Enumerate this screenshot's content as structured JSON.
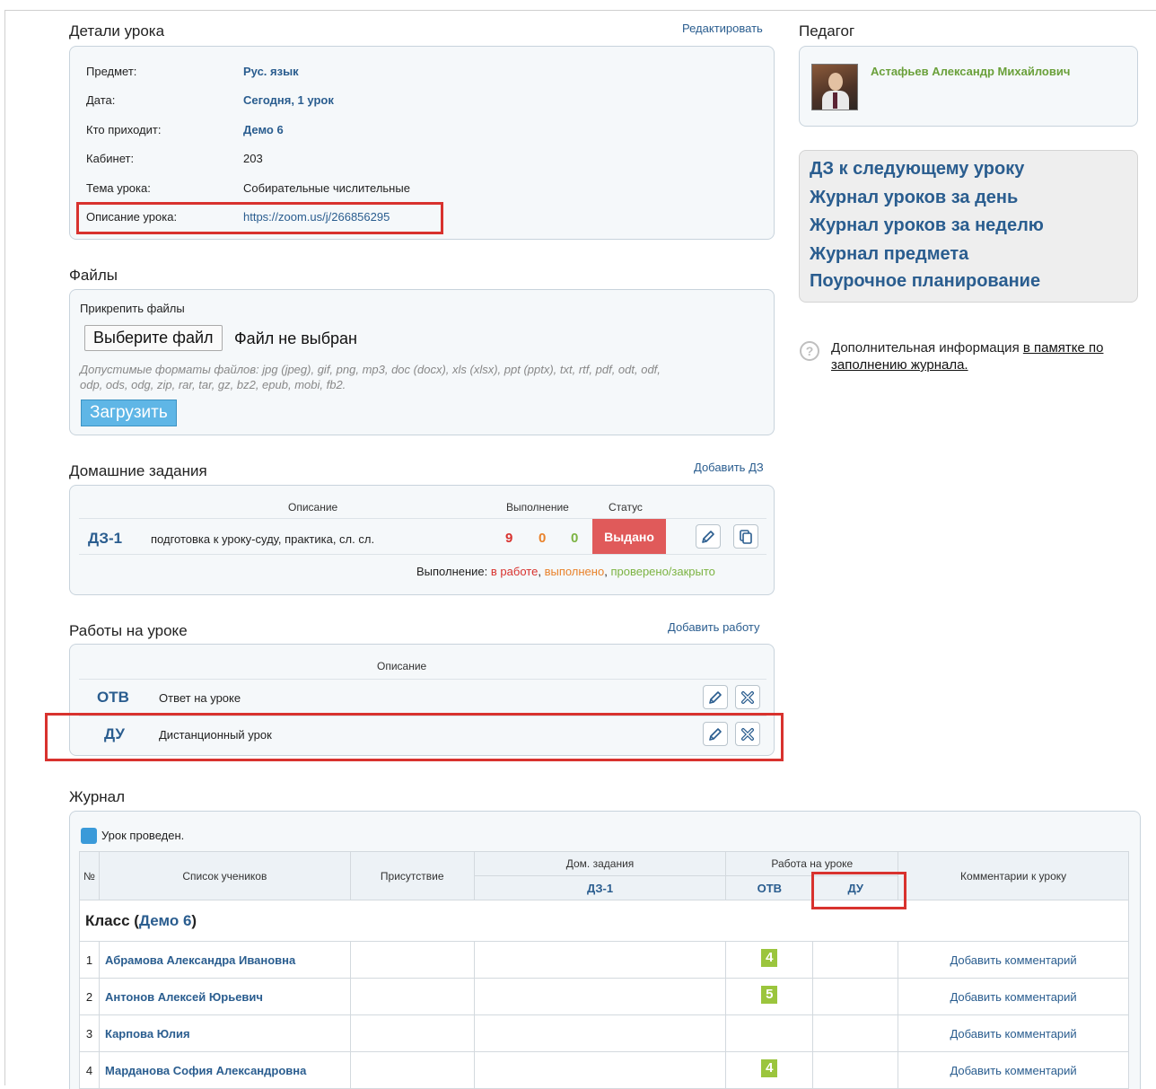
{
  "details": {
    "title": "Детали урока",
    "edit_link": "Редактировать",
    "rows": [
      {
        "label": "Предмет:",
        "value": "Рус. язык"
      },
      {
        "label": "Дата:",
        "value": "Сегодня, 1 урок"
      },
      {
        "label": "Кто приходит:",
        "value": "Демо 6"
      },
      {
        "label": "Кабинет:",
        "value": "203"
      },
      {
        "label": "Тема урока:",
        "value": "Собирательные числительные"
      },
      {
        "label": "Описание урока:",
        "value": "https://zoom.us/j/266856295"
      }
    ]
  },
  "files": {
    "title": "Файлы",
    "attach_label": "Прикрепить файлы",
    "choose_button": "Выберите файл",
    "no_file": "Файл не выбран",
    "formats_line1": "Допустимые форматы файлов: jpg (jpeg), gif, png, mp3, doc (docx), xls (xlsx), ppt (pptx), txt, rtf, pdf, odt, odf,",
    "formats_line2": "odp, ods, odg, zip, rar, tar, gz, bz2, epub, mobi, fb2.",
    "upload_button": "Загрузить"
  },
  "homework": {
    "title": "Домашние задания",
    "add_link": "Добавить ДЗ",
    "headers": {
      "description": "Описание",
      "completion": "Выполнение",
      "status": "Статус"
    },
    "row": {
      "code": "ДЗ-1",
      "description": "подготовка к уроку-суду, практика, сл. сл.",
      "in_progress": "9",
      "done": "0",
      "checked": "0",
      "status": "Выдано"
    },
    "legend": {
      "prefix": "Выполнение:",
      "in_progress": "в работе",
      "sep1": ",",
      "done": "выполнено",
      "sep2": ",",
      "checked": "проверено/закрыто"
    }
  },
  "works": {
    "title": "Работы на уроке",
    "add_link": "Добавить работу",
    "header": "Описание",
    "rows": [
      {
        "code": "ОТВ",
        "description": "Ответ на уроке"
      },
      {
        "code": "ДУ",
        "description": "Дистанционный урок"
      }
    ]
  },
  "teacher": {
    "title": "Педагог",
    "name": "Астафьев Александр Михайлович"
  },
  "quick_links": [
    "ДЗ к следующему уроку",
    "Журнал уроков за день",
    "Журнал уроков за неделю",
    "Журнал предмета",
    "Поурочное планирование"
  ],
  "help": {
    "icon": "?",
    "text": "Дополнительная информация",
    "link1": "в памятке по",
    "link2": "заполнению журнала."
  },
  "journal": {
    "title": "Журнал",
    "lesson_done": "Урок проведен.",
    "headers": {
      "num": "№",
      "students": "Список учеников",
      "presence": "Присутствие",
      "homework": "Дом. задания",
      "homework_sub": "ДЗ-1",
      "classwork": "Работа на уроке",
      "classwork_sub1": "ОТВ",
      "classwork_sub2": "ДУ",
      "comments": "Комментарии к уроку"
    },
    "class_prefix": "Класс (",
    "class_name": "Демо 6",
    "class_suffix": ")",
    "students": [
      {
        "num": "1",
        "name": "Абрамова Александра Ивановна",
        "grade": "4",
        "comment": "Добавить комментарий"
      },
      {
        "num": "2",
        "name": "Антонов Алексей Юрьевич",
        "grade": "5",
        "comment": "Добавить комментарий"
      },
      {
        "num": "3",
        "name": "Карпова Юлия",
        "grade": "",
        "comment": "Добавить комментарий"
      },
      {
        "num": "4",
        "name": "Марданова София Александровна",
        "grade": "4",
        "comment": "Добавить комментарий"
      }
    ]
  },
  "colors": {
    "link": "#2a5d8f",
    "status_red": "#e05a5a",
    "in_progress": "#d8322e",
    "done": "#e9822b",
    "checked": "#7cb342",
    "grade": "#9bc53d",
    "highlight": "#d8322e"
  }
}
